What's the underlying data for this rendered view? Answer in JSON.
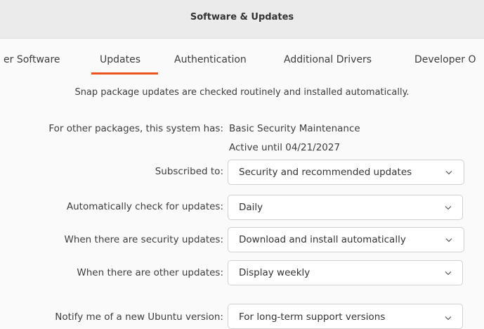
{
  "window": {
    "title": "Software & Updates"
  },
  "tabs": [
    {
      "label": "er Software"
    },
    {
      "label": "Updates",
      "selected": true
    },
    {
      "label": "Authentication"
    },
    {
      "label": "Additional Drivers"
    },
    {
      "label": "Developer O"
    }
  ],
  "accent_color": "#e95420",
  "snap_note": "Snap package updates are checked routinely and installed automatically.",
  "system": {
    "label": "For other packages, this system has:",
    "plan": "Basic Security Maintenance",
    "active_until": "Active until 04/21/2027"
  },
  "settings": [
    {
      "id": "subscribed",
      "label": "Subscribed to:",
      "value": "Security and recommended updates"
    },
    {
      "id": "auto-check",
      "label": "Automatically check for updates:",
      "value": "Daily"
    },
    {
      "id": "security-updates",
      "label": "When there are security updates:",
      "value": "Download and install automatically"
    },
    {
      "id": "other-updates",
      "label": "When there are other updates:",
      "value": "Display weekly"
    },
    {
      "id": "notify-version",
      "label": "Notify me of a new Ubuntu version:",
      "value": "For long-term support versions"
    }
  ]
}
